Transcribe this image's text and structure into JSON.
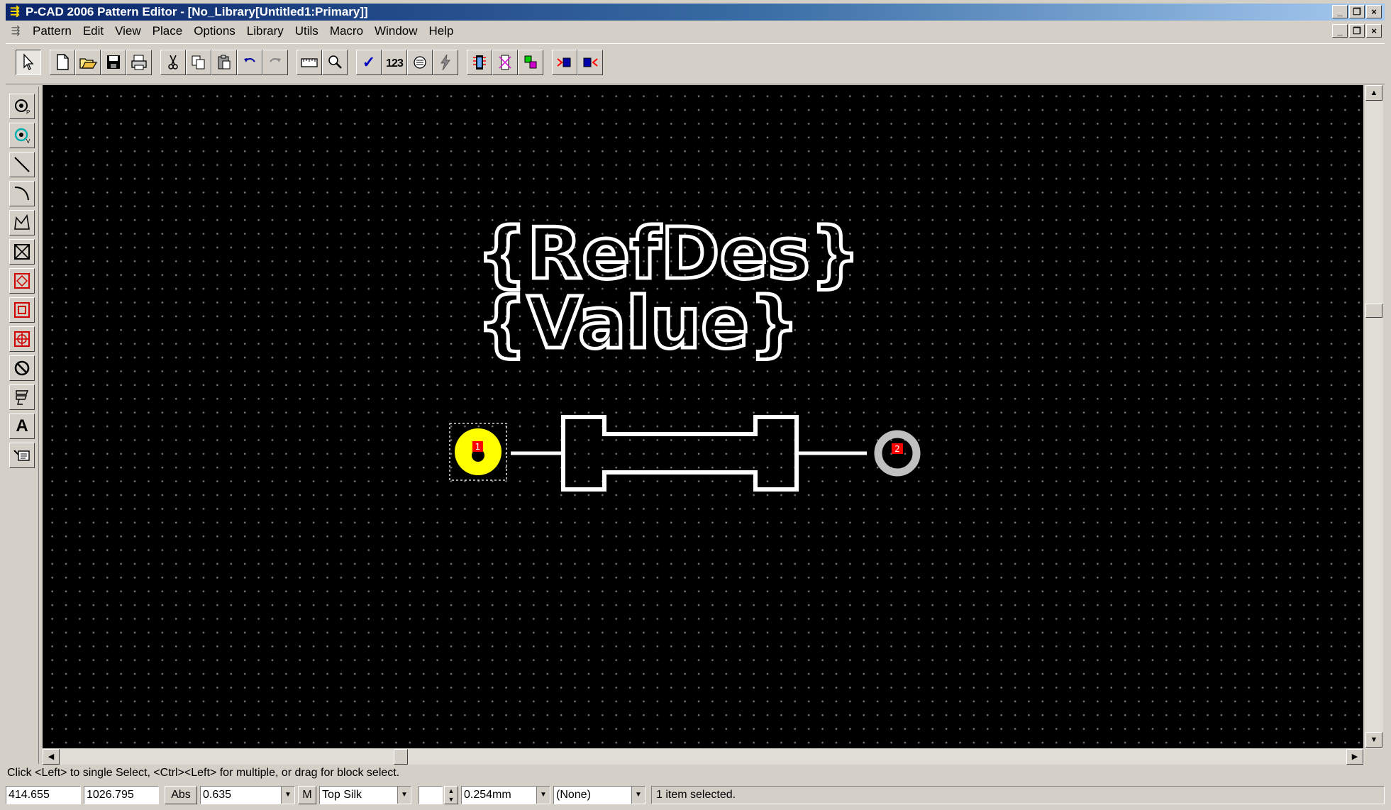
{
  "window": {
    "title": "P-CAD 2006 Pattern Editor - [No_Library[Untitled1:Primary]]"
  },
  "window_controls": {
    "minimize": "_",
    "restore": "❐",
    "close": "×"
  },
  "menu": [
    "Pattern",
    "Edit",
    "View",
    "Place",
    "Options",
    "Library",
    "Utils",
    "Macro",
    "Window",
    "Help"
  ],
  "toolbar": {
    "check_label": "✓",
    "renumber_label": "123"
  },
  "design": {
    "refdes_text": "{RefDes}",
    "value_text": "{Value}",
    "pad1_number": "1",
    "pad2_number": "2",
    "pad1_color": "#ffff00",
    "pad2_color": "#c0c0c0",
    "pad_number_color": "#ff0000",
    "silk_color": "#ffffff",
    "pad1_selected": true
  },
  "left_toolbar": {
    "text_tool_label": "A"
  },
  "hint": "Click <Left> to single Select, <Ctrl><Left> for multiple, or drag for block select.",
  "status": {
    "x": "414.655",
    "y": "1026.795",
    "mode": "Abs",
    "grid": "0.635",
    "m_button": "M",
    "layer": "Top Silk",
    "line_width": "0.254mm",
    "net": "(None)",
    "message": "1 item selected."
  }
}
